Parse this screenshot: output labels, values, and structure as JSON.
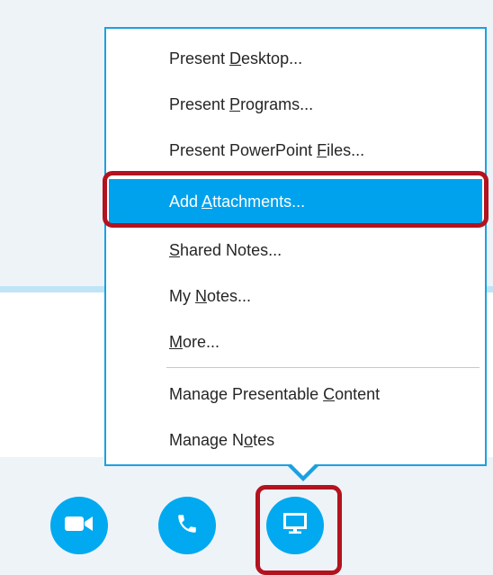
{
  "colors": {
    "accent": "#00a2ed",
    "button_blue": "#00a9f0",
    "highlight_red": "#b3131e",
    "menu_border": "#1aa1e1"
  },
  "menu": {
    "items": [
      {
        "label": "Present Desktop...",
        "parts": [
          "Present ",
          "D",
          "esktop..."
        ]
      },
      {
        "label": "Present Programs...",
        "parts": [
          "Present ",
          "P",
          "rograms..."
        ]
      },
      {
        "label": "Present PowerPoint Files...",
        "parts": [
          "Present PowerPoint ",
          "F",
          "iles..."
        ]
      },
      {
        "label": "Add Attachments...",
        "parts": [
          "Add ",
          "A",
          "ttachments..."
        ],
        "selected": true
      },
      {
        "label": "Shared Notes...",
        "parts": [
          "",
          "S",
          "hared Notes..."
        ]
      },
      {
        "label": "My Notes...",
        "parts": [
          "My ",
          "N",
          "otes..."
        ]
      },
      {
        "label": "More...",
        "parts": [
          "",
          "M",
          "ore..."
        ]
      },
      {
        "label": "Manage Presentable Content",
        "parts": [
          "Manage Presentable ",
          "C",
          "ontent"
        ]
      },
      {
        "label": "Manage Notes",
        "parts": [
          "Manage N",
          "o",
          "tes"
        ]
      }
    ]
  },
  "toolbar": {
    "buttons": [
      {
        "name": "video",
        "icon": "video-camera-icon"
      },
      {
        "name": "call",
        "icon": "phone-icon"
      },
      {
        "name": "present",
        "icon": "monitor-icon",
        "highlighted": true
      }
    ]
  }
}
